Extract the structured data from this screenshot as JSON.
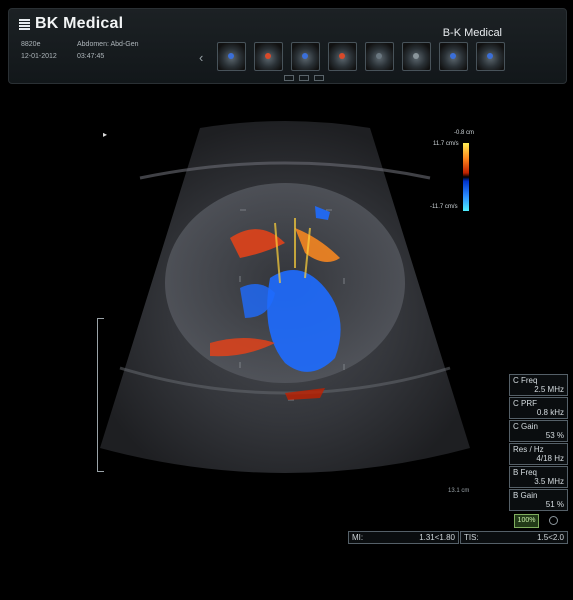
{
  "header": {
    "brand": "BK Medical",
    "brand_right": "B-K Medical",
    "model": "8820e",
    "preset": "Abdomen: Abd-Gen",
    "date": "12-01-2012",
    "time": "03:47:45",
    "thumbnail_count": 8
  },
  "color_bar": {
    "top_label": "-0.8 cm",
    "max_velocity": "11.7 cm/s",
    "min_velocity": "-11.7 cm/s"
  },
  "depth_label": "13.1 cm",
  "parameters": [
    {
      "name": "C Freq",
      "value": "2.5 MHz"
    },
    {
      "name": "C PRF",
      "value": "0.8 kHz"
    },
    {
      "name": "C Gain",
      "value": "53 %"
    },
    {
      "name": "Res / Hz",
      "value": "4/18 Hz"
    },
    {
      "name": "B Freq",
      "value": "3.5 MHz"
    },
    {
      "name": "B Gain",
      "value": "51 %"
    }
  ],
  "zoom": "100%",
  "indices": {
    "mi_label": "MI:",
    "mi_value": "1.31<1.80",
    "tis_label": "TIS:",
    "tis_value": "1.5<2.0"
  },
  "colors": {
    "doppler_red": "#e0421a",
    "doppler_blue": "#1e6cff",
    "zoom_green": "#7fae5e"
  }
}
